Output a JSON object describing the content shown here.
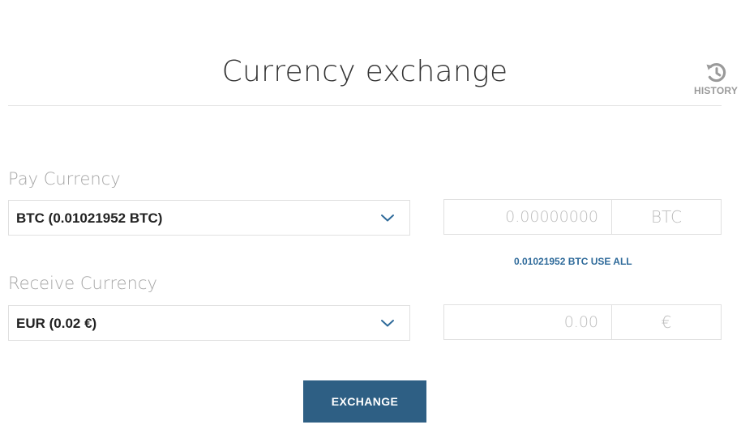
{
  "header": {
    "title": "Currency exchange",
    "history_label": "HISTORY",
    "history_icon": "history-icon"
  },
  "pay": {
    "label": "Pay Currency",
    "selected": "BTC (0.01021952 BTC)",
    "chevron_icon": "chevron-down-icon",
    "amount_placeholder": "0.00000000",
    "unit": "BTC",
    "use_all": "0.01021952 BTC USE ALL"
  },
  "receive": {
    "label": "Receive Currency",
    "selected": "EUR (0.02 €)",
    "chevron_icon": "chevron-down-icon",
    "amount_placeholder": "0.00",
    "unit": "€"
  },
  "actions": {
    "exchange_label": "EXCHANGE"
  },
  "colors": {
    "accent": "#2e6a9a",
    "button": "#2e5f84",
    "muted": "#a6a6a6"
  }
}
